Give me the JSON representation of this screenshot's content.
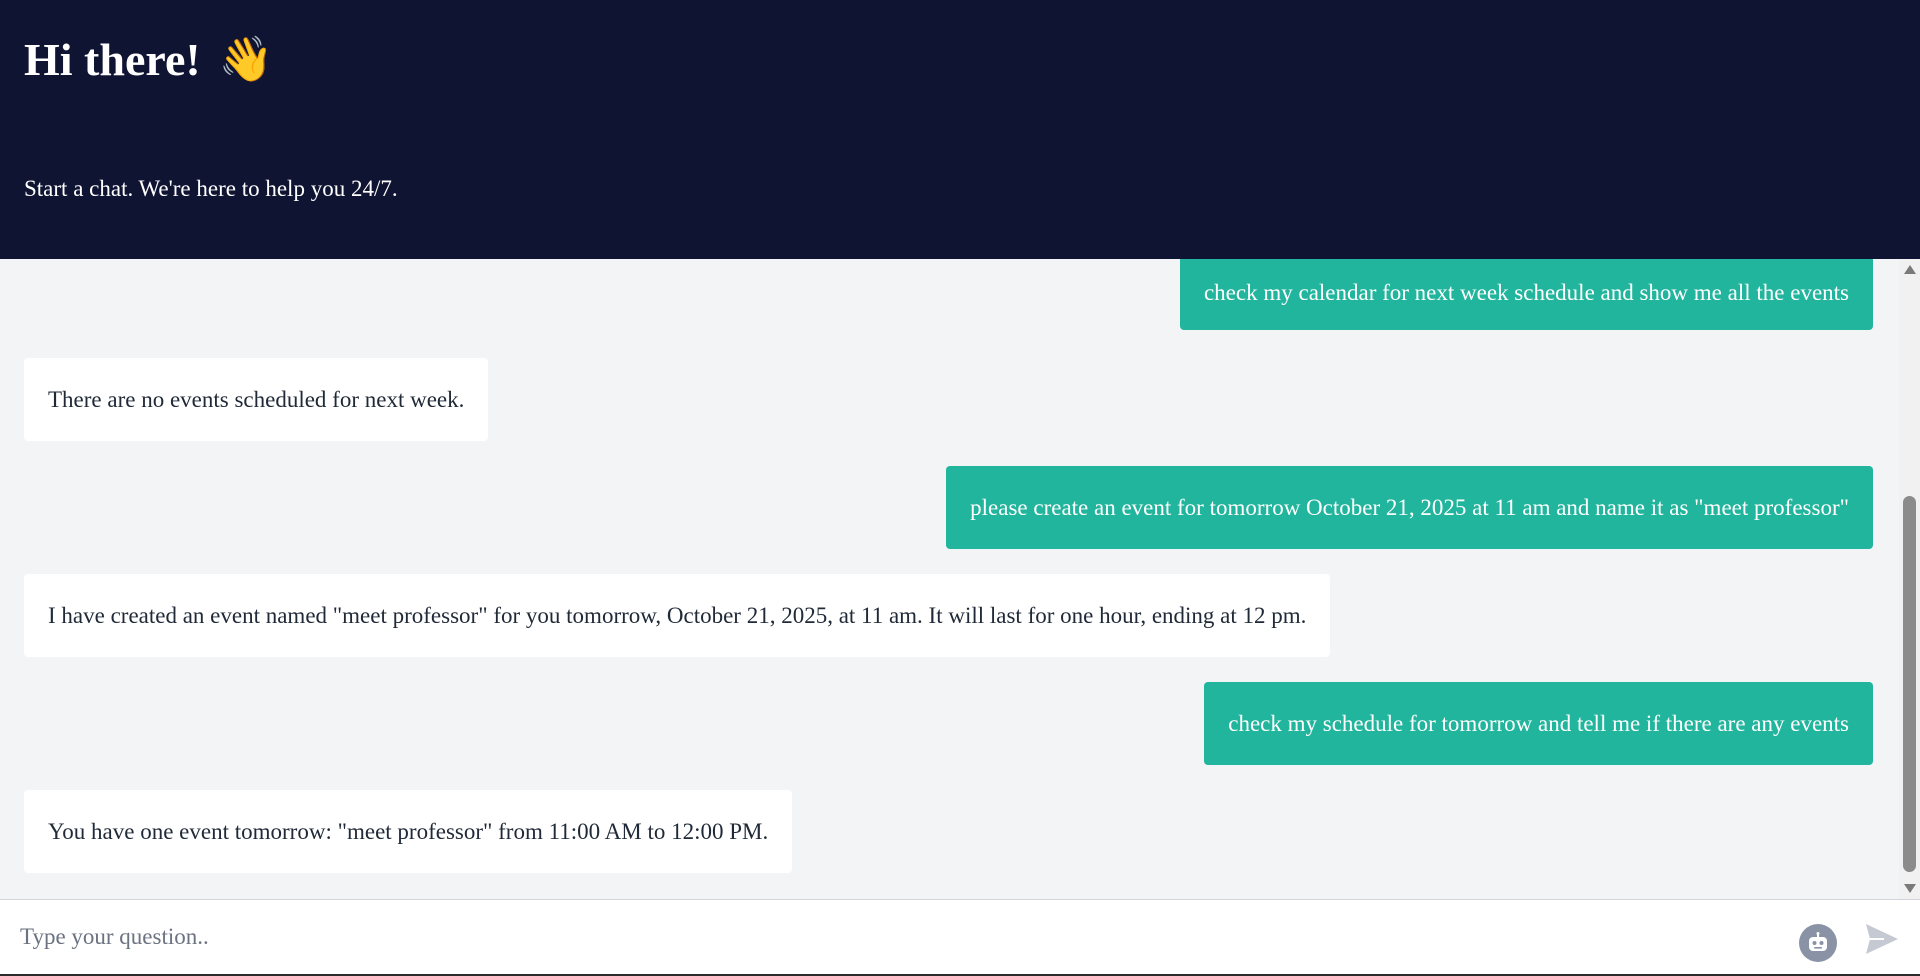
{
  "header": {
    "title": "Hi there!",
    "wave_emoji": "👋",
    "subtitle": "Start a chat. We're here to help you 24/7."
  },
  "messages": [
    {
      "role": "user",
      "text": "check my calendar for next week schedule and show me all the events"
    },
    {
      "role": "bot",
      "text": "There are no events scheduled for next week."
    },
    {
      "role": "user",
      "text": "please create an event for tomorrow October 21, 2025 at 11 am and name it as \"meet professor\""
    },
    {
      "role": "bot",
      "text": "I have created an event named \"meet professor\" for you tomorrow, October 21, 2025, at 11 am. It will last for one hour, ending at 12 pm."
    },
    {
      "role": "user",
      "text": "check my schedule for tomorrow and tell me if there are any events"
    },
    {
      "role": "bot",
      "text": "You have one event tomorrow: \"meet professor\" from 11:00 AM to 12:00 PM."
    }
  ],
  "input": {
    "placeholder": "Type your question..",
    "value": ""
  },
  "icons": {
    "bot": "robot-icon",
    "send": "send-icon",
    "wave": "waving-hand-icon"
  },
  "colors": {
    "header_bg": "#101433",
    "user_bubble": "#20b59c",
    "bot_bubble": "#ffffff",
    "chat_bg": "#f3f4f6"
  }
}
